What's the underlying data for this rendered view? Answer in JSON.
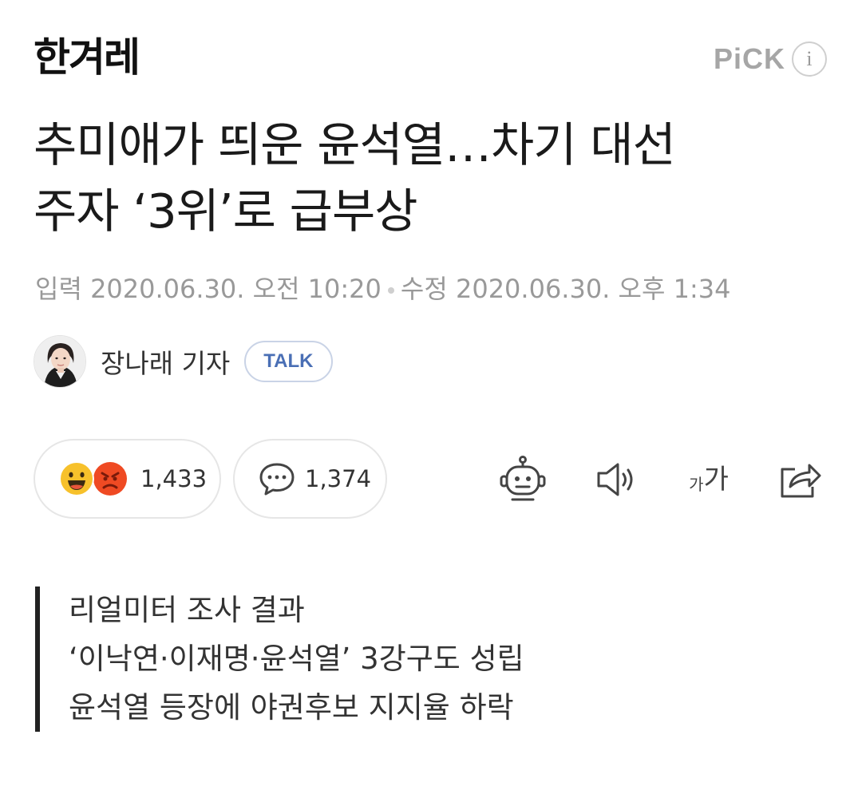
{
  "header": {
    "logo_text": "한겨레",
    "pick_label": "PiCK",
    "info_icon": "i"
  },
  "article": {
    "title_line1": "추미애가 띄운 윤석열…차기 대선",
    "title_line2": "주자 ‘3위’로 급부상",
    "meta": {
      "input_label": "입력",
      "input_time": "2020.06.30. 오전 10:20",
      "modified_label": "수정",
      "modified_time": "2020.06.30. 오후 1:34"
    },
    "author": {
      "name": "장나래 기자",
      "talk_label": "TALK"
    },
    "reactions": {
      "count": "1,433",
      "icons": [
        "smile-emoji-icon",
        "angry-emoji-icon"
      ]
    },
    "comments": {
      "count": "1,374"
    },
    "toolbar": {
      "icons": [
        "robot-summary-icon",
        "speaker-icon",
        "font-size-icon",
        "share-icon"
      ],
      "font_small": "가",
      "font_large": "가"
    },
    "subheadings": [
      "리얼미터 조사 결과",
      "‘이낙연·이재명·윤석열’ 3강구도 성립",
      "윤석열 등장에 야권후보 지지율 하락"
    ]
  },
  "colors": {
    "text": "#1a1a1a",
    "meta_gray": "#999999",
    "talk_blue": "#4a6fb5",
    "pick_gray": "#a6a6a6",
    "emoji_yellow": "#f7c12b",
    "emoji_red": "#ef4a23"
  }
}
